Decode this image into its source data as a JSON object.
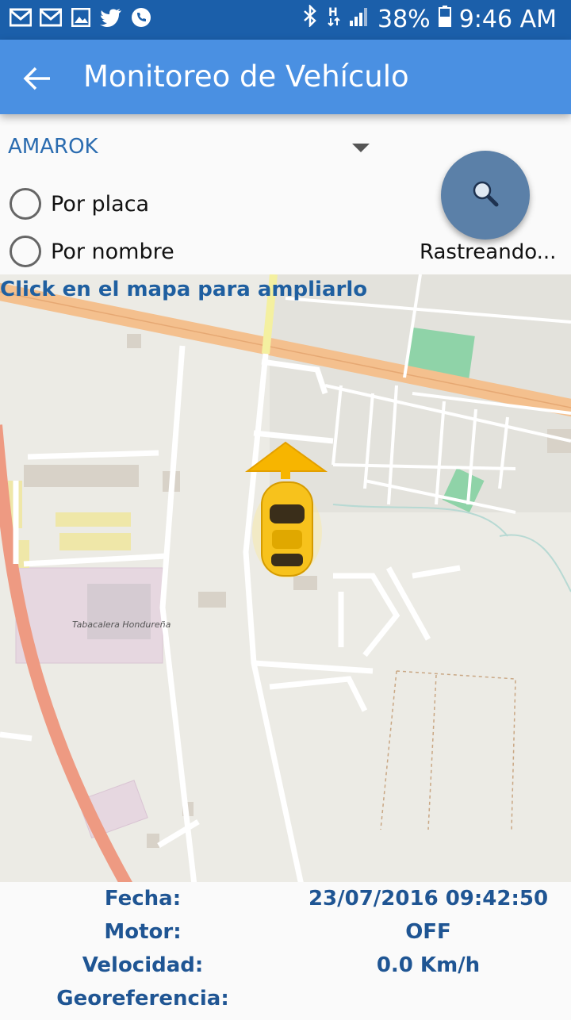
{
  "status_bar": {
    "battery": "38%",
    "time": "9:46 AM",
    "left_icons": [
      "gmail-icon",
      "gmail-icon",
      "image-icon",
      "twitter-icon",
      "phone-icon"
    ],
    "right_icons": [
      "bluetooth-icon",
      "h-network-icon",
      "signal-icon",
      "battery-icon"
    ]
  },
  "app_bar": {
    "title": "Monitoreo de Vehículo",
    "back_icon": "arrow-back-icon",
    "color": "#4a90e2"
  },
  "vehicle_select": {
    "value": "AMAROK"
  },
  "search_mode": {
    "options": [
      {
        "label": "Por placa",
        "selected": false
      },
      {
        "label": "Por nombre",
        "selected": false
      }
    ]
  },
  "track_button": {
    "icon": "search-icon",
    "label": "Rastreando..."
  },
  "map": {
    "hint": "Click en el mapa para ampliarlo",
    "marker_icon": "car-icon",
    "heading_icon": "arrow-up-icon",
    "place_label": "Tabacalera Hondureña"
  },
  "info": {
    "fecha_label": "Fecha:",
    "fecha_value": "23/07/2016 09:42:50",
    "motor_label": "Motor:",
    "motor_value": "OFF",
    "velocidad_label": "Velocidad:",
    "velocidad_value": "0.0 Km/h",
    "georef_label": "Georeferencia:",
    "georef_value": ""
  },
  "colors": {
    "status_bar": "#1b5faa",
    "accent_text": "#1f5593",
    "fab": "#5b80a8"
  }
}
